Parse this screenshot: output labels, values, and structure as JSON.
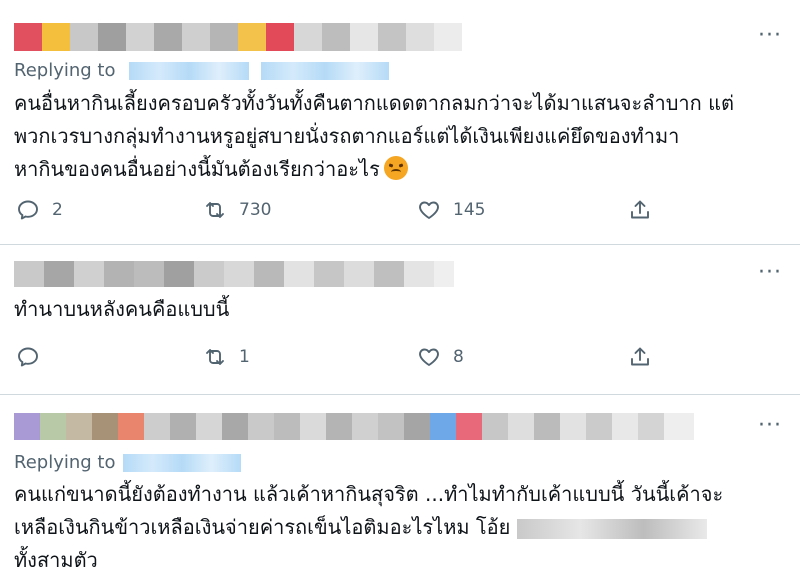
{
  "tweets": [
    {
      "replying_label": "Replying to",
      "text_lines": [
        "คนอื่นหากินเลี้ยงครอบครัวทั้งวันทั้งคืนตากแดดตากลมกว่าจะได้มาแสนจะลำบาก แต่",
        "พวกเวรบางกลุ่มทำงานหรูอยู่สบายนั่งรถตากแอร์แต่ได้เงินเพียงแค่ยึดของทำมา",
        "หากินของคนอื่นอย่างนี้มันต้องเรียกว่าอะไร"
      ],
      "emoji": "pouting-face",
      "replies": "2",
      "retweets": "730",
      "likes": "145"
    },
    {
      "text_lines": [
        "ทำนาบนหลังคนคือแบบนี้"
      ],
      "replies": "",
      "retweets": "1",
      "likes": "8"
    },
    {
      "replying_label": "Replying to",
      "text_lines": [
        "คนแก่ขนาดนี้ยังต้องทำงาน แล้วเค้าหากินสุจริต ...ทำไมทำกับเค้าแบบนี้ วันนี้เค้าจะ",
        "เหลือเงินกินข้าวเหลือเงินจ่ายค่ารถเข็นไอติมอะไรไหม โอ้ย",
        "ทั้งสามตัว"
      ]
    }
  ],
  "more_glyph": "···",
  "colors": {
    "muted": "#536471",
    "text": "#0f1419",
    "separator": "#cfd9de"
  }
}
